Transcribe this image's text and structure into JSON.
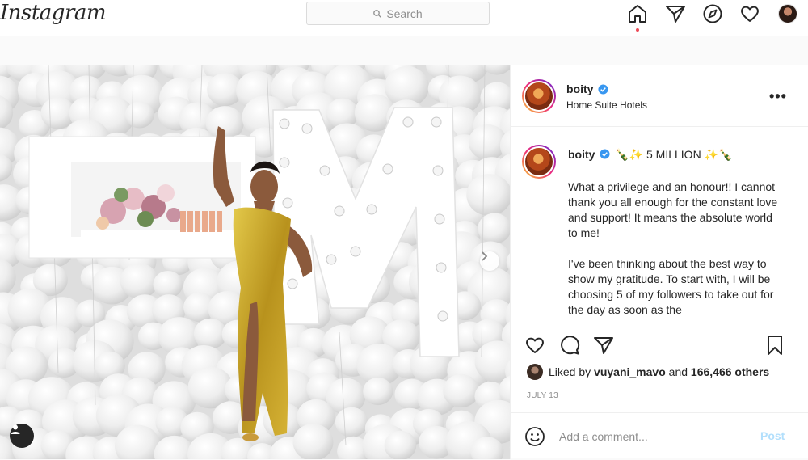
{
  "app": {
    "logo": "Instagram"
  },
  "search": {
    "placeholder": "Search"
  },
  "nav": {
    "icons": [
      "home-icon",
      "direct-icon",
      "explore-icon",
      "activity-icon",
      "profile-avatar"
    ],
    "active": "home"
  },
  "post": {
    "author": {
      "username": "boity",
      "verified": true,
      "location": "Home Suite Hotels"
    },
    "caption": {
      "username": "boity",
      "headline": "🍾✨ 5 MILLION ✨🍾",
      "paragraphs": [
        "What a privilege and an honour!! I cannot thank you all enough for the constant love and support! It means the absolute world to me!",
        "I've been thinking about the best way to show my gratitude. To start with, I will be choosing 5 of my followers to take out for the day as soon as the"
      ]
    },
    "likes": {
      "prefix": "Liked by",
      "user": "vuyani_mavo",
      "joiner": "and",
      "others": "166,466 others"
    },
    "date": "JULY 13",
    "comment": {
      "placeholder": "Add a comment...",
      "post_label": "Post"
    }
  },
  "colors": {
    "accent": "#0095f6",
    "post_disabled": "#b2dffc",
    "verified": "#3897f0",
    "notification": "#ed4956",
    "dress": "#c9a227"
  }
}
